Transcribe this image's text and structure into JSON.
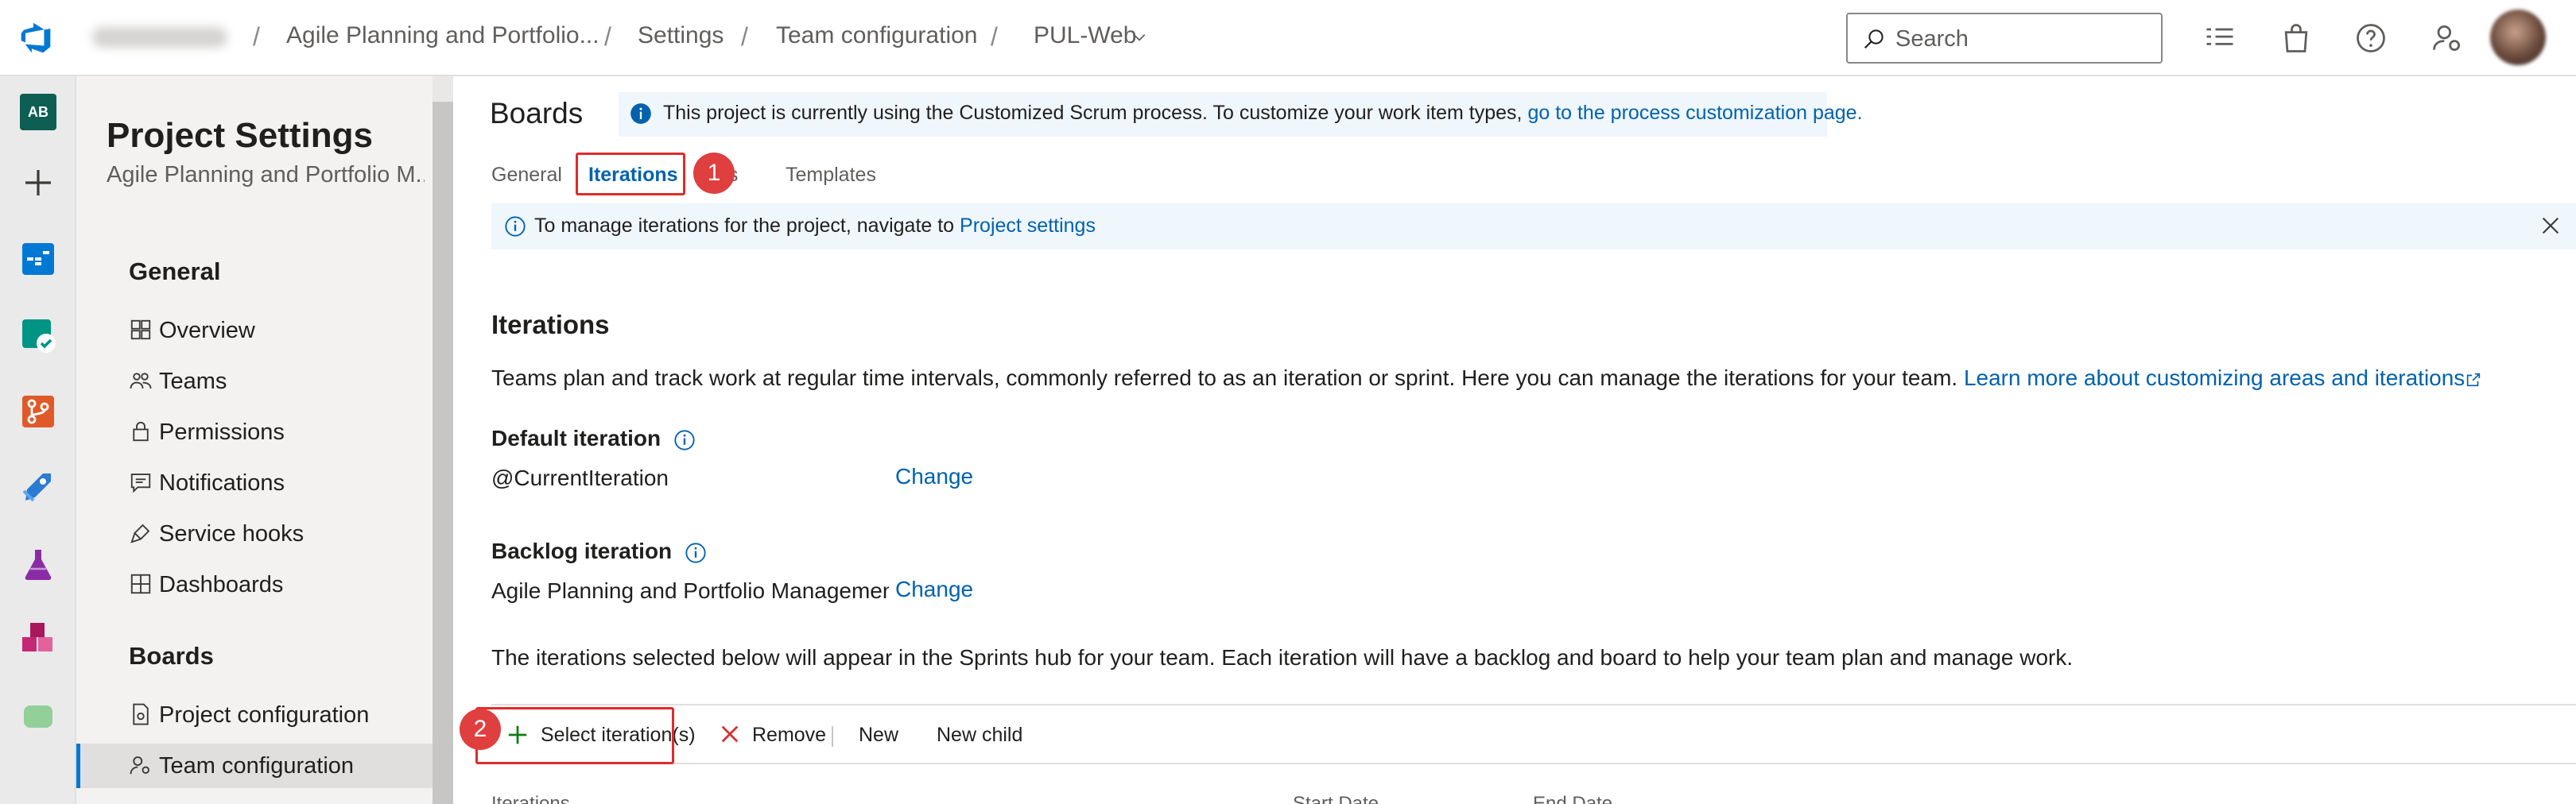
{
  "topbar": {
    "breadcrumbs": [
      "Agile Planning and Portfolio...",
      "Settings",
      "Team configuration",
      "PUL-Web"
    ],
    "search_placeholder": "Search",
    "icons": [
      "azure-devops-logo-icon",
      "work-items-icon",
      "marketplace-bag-icon",
      "help-icon",
      "user-settings-icon"
    ]
  },
  "rail": {
    "project_initials": "AB",
    "items": [
      "add-icon",
      "boards-icon",
      "test-plans-check-icon",
      "repos-icon",
      "pipelines-icon",
      "test-flask-icon",
      "artifacts-icon",
      "extension-icon"
    ]
  },
  "settings_nav": {
    "title": "Project Settings",
    "subtitle": "Agile Planning and Portfolio M...",
    "sections": [
      {
        "label": "General",
        "items": [
          {
            "label": "Overview",
            "icon": "overview-icon"
          },
          {
            "label": "Teams",
            "icon": "teams-icon"
          },
          {
            "label": "Permissions",
            "icon": "lock-icon"
          },
          {
            "label": "Notifications",
            "icon": "notifications-icon"
          },
          {
            "label": "Service hooks",
            "icon": "service-hooks-icon"
          },
          {
            "label": "Dashboards",
            "icon": "dashboards-icon"
          }
        ]
      },
      {
        "label": "Boards",
        "items": [
          {
            "label": "Project configuration",
            "icon": "project-config-icon"
          },
          {
            "label": "Team configuration",
            "icon": "team-config-icon",
            "active": true
          }
        ]
      }
    ]
  },
  "main": {
    "heading": "Boards",
    "process_banner": {
      "text": "This project is currently using the Customized Scrum process. To customize your work item types, ",
      "link": "go to the process customization page."
    },
    "tabs": [
      "General",
      "Iterations",
      "as",
      "Templates"
    ],
    "active_tab": "Iterations",
    "manage_banner": {
      "text": "To manage iterations for the project, navigate to ",
      "link": "Project settings"
    },
    "section_title": "Iterations",
    "description": "Teams plan and track work at regular time intervals, commonly referred to as an iteration or sprint. Here you can manage the iterations for your team.",
    "learn_more": "Learn more about customizing areas and iterations",
    "default_iteration": {
      "label": "Default iteration",
      "value": "@CurrentIteration",
      "change": "Change"
    },
    "backlog_iteration": {
      "label": "Backlog iteration",
      "value": "Agile Planning and Portfolio Management",
      "change": "Change"
    },
    "selected_note": "The iterations selected below will appear in the Sprints hub for your team. Each iteration will have a backlog and board to help your team plan and manage work.",
    "toolbar": {
      "select": "Select iteration(s)",
      "remove": "Remove",
      "new": "New",
      "new_child": "New child"
    },
    "columns": [
      "Iterations",
      "Start Date",
      "End Date"
    ],
    "step_badges": [
      "1",
      "2"
    ]
  },
  "colors": {
    "accent": "#0078d4",
    "link": "#0062ad",
    "callout_red": "#e02b2b",
    "banner_bg": "#eff6fc",
    "add_green": "#107c10",
    "remove_red": "#d13438"
  }
}
